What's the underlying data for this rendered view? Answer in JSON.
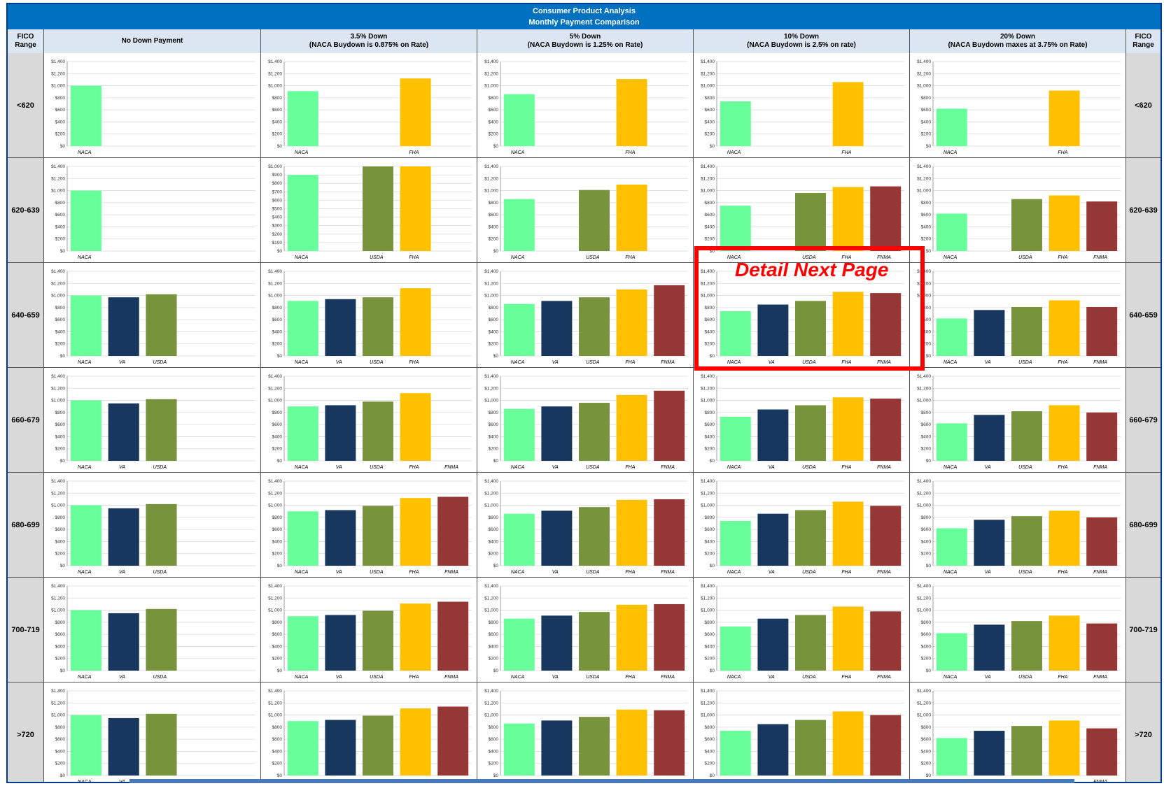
{
  "title": {
    "line1": "Consumer Product Analysis",
    "line2": "Monthly Payment Comparison"
  },
  "headers": {
    "fico_left": "FICO Range",
    "fico_right": "FICO Range",
    "columns": [
      {
        "line1": "No Down Payment",
        "line2": ""
      },
      {
        "line1": "3.5% Down",
        "line2": "(NACA Buydown is 0.875% on Rate)"
      },
      {
        "line1": "5% Down",
        "line2": "(NACA Buydown is 1.25% on Rate)"
      },
      {
        "line1": "10% Down",
        "line2": "(NACA Buydown is 2.5% on rate)"
      },
      {
        "line1": "20% Down",
        "line2": "(NACA Buydown maxes at 3.75% on Rate)"
      }
    ]
  },
  "fico_ranges": [
    "<620",
    "620-639",
    "640-659",
    "660-679",
    "680-699",
    "700-719",
    ">720"
  ],
  "annotation": {
    "text": "Detail Next Page"
  },
  "colors": {
    "NACA": "#66ff99",
    "VA": "#17375e",
    "USDA": "#77933c",
    "FHA": "#ffc000",
    "FNMA": "#953735",
    "title_bg": "#0070c0",
    "header_bg": "#dce6f2",
    "fico_bg": "#d9d9d9",
    "highlight": "#ff0000"
  },
  "chart_data": [
    {
      "type": "bar",
      "fico": "<620",
      "column": "No Down Payment",
      "ylim": [
        0,
        1400
      ],
      "yticks": [
        "$0",
        "$200",
        "$400",
        "$600",
        "$800",
        "$1,000",
        "$1,200",
        "$1,400"
      ],
      "categories": [
        "NACA",
        "",
        "",
        "",
        ""
      ],
      "values": [
        1000,
        null,
        null,
        null,
        null
      ]
    },
    {
      "type": "bar",
      "fico": "<620",
      "column": "3.5% Down",
      "ylim": [
        0,
        1400
      ],
      "yticks": [
        "$0",
        "$200",
        "$400",
        "$600",
        "$800",
        "$1,000",
        "$1,200",
        "$1,400"
      ],
      "categories": [
        "NACA",
        "",
        "",
        "FHA",
        ""
      ],
      "values": [
        910,
        null,
        null,
        1120,
        null
      ]
    },
    {
      "type": "bar",
      "fico": "<620",
      "column": "5% Down",
      "ylim": [
        0,
        1400
      ],
      "yticks": [
        "$0",
        "$200",
        "$400",
        "$600",
        "$800",
        "$1,000",
        "$1,200",
        "$1,400"
      ],
      "categories": [
        "NACA",
        "",
        "",
        "FHA",
        ""
      ],
      "values": [
        860,
        null,
        null,
        1110,
        null
      ]
    },
    {
      "type": "bar",
      "fico": "<620",
      "column": "10% Down",
      "ylim": [
        0,
        1400
      ],
      "yticks": [
        "$0",
        "$200",
        "$400",
        "$600",
        "$800",
        "$1,000",
        "$1,200",
        "$1,400"
      ],
      "categories": [
        "NACA",
        "",
        "",
        "FHA",
        ""
      ],
      "values": [
        740,
        null,
        null,
        1060,
        null
      ]
    },
    {
      "type": "bar",
      "fico": "<620",
      "column": "20% Down",
      "ylim": [
        0,
        1400
      ],
      "yticks": [
        "$0",
        "$200",
        "$400",
        "$600",
        "$800",
        "$1,000",
        "$1,200",
        "$1,400"
      ],
      "categories": [
        "NACA",
        "",
        "",
        "FHA",
        ""
      ],
      "values": [
        620,
        null,
        null,
        920,
        null
      ]
    },
    {
      "type": "bar",
      "fico": "620-639",
      "column": "No Down Payment",
      "ylim": [
        0,
        1400
      ],
      "yticks": [
        "$0",
        "$200",
        "$400",
        "$600",
        "$800",
        "$1,000",
        "$1,200",
        "$1,400"
      ],
      "categories": [
        "NACA",
        "",
        "",
        "",
        ""
      ],
      "values": [
        1000,
        null,
        null,
        null,
        null
      ]
    },
    {
      "type": "bar",
      "fico": "620-639",
      "column": "3.5% Down",
      "ylim": [
        0,
        1000
      ],
      "yticks": [
        "$0",
        "$100",
        "$200",
        "$300",
        "$400",
        "$500",
        "$600",
        "$700",
        "$800",
        "$900",
        "$1,000"
      ],
      "categories": [
        "NACA",
        "",
        "USDA",
        "FHA",
        ""
      ],
      "values": [
        900,
        null,
        1000,
        1000,
        null
      ]
    },
    {
      "type": "bar",
      "fico": "620-639",
      "column": "5% Down",
      "ylim": [
        0,
        1400
      ],
      "yticks": [
        "$0",
        "$200",
        "$400",
        "$600",
        "$800",
        "$1,000",
        "$1,200",
        "$1,400"
      ],
      "categories": [
        "NACA",
        "",
        "USDA",
        "FHA",
        ""
      ],
      "values": [
        860,
        null,
        1010,
        1100,
        null
      ]
    },
    {
      "type": "bar",
      "fico": "620-639",
      "column": "10% Down",
      "ylim": [
        0,
        1400
      ],
      "yticks": [
        "$0",
        "$200",
        "$400",
        "$600",
        "$800",
        "$1,000",
        "$1,200",
        "$1,400"
      ],
      "categories": [
        "NACA",
        "",
        "USDA",
        "FHA",
        "FNMA"
      ],
      "values": [
        750,
        null,
        960,
        1060,
        1070
      ]
    },
    {
      "type": "bar",
      "fico": "620-639",
      "column": "20% Down",
      "ylim": [
        0,
        1400
      ],
      "yticks": [
        "$0",
        "$200",
        "$400",
        "$600",
        "$800",
        "$1,000",
        "$1,200",
        "$1,400"
      ],
      "categories": [
        "NACA",
        "",
        "USDA",
        "FHA",
        "FNMA"
      ],
      "values": [
        620,
        null,
        860,
        920,
        820
      ]
    },
    {
      "type": "bar",
      "fico": "640-659",
      "column": "No Down Payment",
      "ylim": [
        0,
        1400
      ],
      "yticks": [
        "$0",
        "$200",
        "$400",
        "$600",
        "$800",
        "$1,000",
        "$1,200",
        "$1,400"
      ],
      "categories": [
        "NACA",
        "VA",
        "USDA",
        "",
        ""
      ],
      "values": [
        1000,
        970,
        1020,
        null,
        null
      ]
    },
    {
      "type": "bar",
      "fico": "640-659",
      "column": "3.5% Down",
      "ylim": [
        0,
        1400
      ],
      "yticks": [
        "$0",
        "$200",
        "$400",
        "$600",
        "$800",
        "$1,000",
        "$1,200",
        "$1,400"
      ],
      "categories": [
        "NACA",
        "VA",
        "USDA",
        "FHA",
        ""
      ],
      "values": [
        910,
        940,
        970,
        1120,
        null
      ]
    },
    {
      "type": "bar",
      "fico": "640-659",
      "column": "5% Down",
      "ylim": [
        0,
        1400
      ],
      "yticks": [
        "$0",
        "$200",
        "$400",
        "$600",
        "$800",
        "$1,000",
        "$1,200",
        "$1,400"
      ],
      "categories": [
        "NACA",
        "VA",
        "USDA",
        "FHA",
        "FNMA"
      ],
      "values": [
        860,
        910,
        970,
        1100,
        1170
      ]
    },
    {
      "type": "bar",
      "fico": "640-659",
      "column": "10% Down",
      "ylim": [
        0,
        1400
      ],
      "yticks": [
        "$0",
        "$200",
        "$400",
        "$600",
        "$800",
        "$1,000",
        "$1,200",
        "$1,400"
      ],
      "categories": [
        "NACA",
        "VA",
        "USDA",
        "FHA",
        "FNMA"
      ],
      "values": [
        740,
        850,
        910,
        1060,
        1040
      ]
    },
    {
      "type": "bar",
      "fico": "640-659",
      "column": "20% Down",
      "ylim": [
        0,
        1400
      ],
      "yticks": [
        "$0",
        "$200",
        "$400",
        "$600",
        "$800",
        "$1,000",
        "$1,200",
        "$1,400"
      ],
      "categories": [
        "NACA",
        "VA",
        "USDA",
        "FHA",
        "FNMA"
      ],
      "values": [
        620,
        760,
        810,
        920,
        810
      ]
    },
    {
      "type": "bar",
      "fico": "660-679",
      "column": "No Down Payment",
      "ylim": [
        0,
        1400
      ],
      "yticks": [
        "$0",
        "$200",
        "$400",
        "$600",
        "$800",
        "$1,000",
        "$1,200",
        "$1,400"
      ],
      "categories": [
        "NACA",
        "VA",
        "USDA",
        "",
        ""
      ],
      "values": [
        1000,
        950,
        1020,
        null,
        null
      ]
    },
    {
      "type": "bar",
      "fico": "660-679",
      "column": "3.5% Down",
      "ylim": [
        0,
        1400
      ],
      "yticks": [
        "$0",
        "$200",
        "$400",
        "$600",
        "$800",
        "$1,000",
        "$1,200",
        "$1,400"
      ],
      "categories": [
        "NACA",
        "VA",
        "USDA",
        "FHA",
        "FNMA"
      ],
      "values": [
        900,
        920,
        980,
        1120,
        null
      ]
    },
    {
      "type": "bar",
      "fico": "660-679",
      "column": "5% Down",
      "ylim": [
        0,
        1400
      ],
      "yticks": [
        "$0",
        "$200",
        "$400",
        "$600",
        "$800",
        "$1,000",
        "$1,200",
        "$1,400"
      ],
      "categories": [
        "NACA",
        "VA",
        "USDA",
        "FHA",
        "FNMA"
      ],
      "values": [
        860,
        900,
        960,
        1090,
        1160
      ]
    },
    {
      "type": "bar",
      "fico": "660-679",
      "column": "10% Down",
      "ylim": [
        0,
        1400
      ],
      "yticks": [
        "$0",
        "$200",
        "$400",
        "$600",
        "$800",
        "$1,000",
        "$1,200",
        "$1,400"
      ],
      "categories": [
        "NACA",
        "VA",
        "USDA",
        "FHA",
        "FNMA"
      ],
      "values": [
        730,
        850,
        920,
        1050,
        1030
      ]
    },
    {
      "type": "bar",
      "fico": "660-679",
      "column": "20% Down",
      "ylim": [
        0,
        1400
      ],
      "yticks": [
        "$0",
        "$200",
        "$400",
        "$600",
        "$800",
        "$1,000",
        "$1,200",
        "$1,400"
      ],
      "categories": [
        "NACA",
        "VA",
        "USDA",
        "FHA",
        "FNMA"
      ],
      "values": [
        620,
        760,
        820,
        920,
        800
      ]
    },
    {
      "type": "bar",
      "fico": "680-699",
      "column": "No Down Payment",
      "ylim": [
        0,
        1400
      ],
      "yticks": [
        "$0",
        "$200",
        "$400",
        "$600",
        "$800",
        "$1,000",
        "$1,200",
        "$1,400"
      ],
      "categories": [
        "NACA",
        "VA",
        "USDA",
        "",
        ""
      ],
      "values": [
        1000,
        950,
        1020,
        null,
        null
      ]
    },
    {
      "type": "bar",
      "fico": "680-699",
      "column": "3.5% Down",
      "ylim": [
        0,
        1400
      ],
      "yticks": [
        "$0",
        "$200",
        "$400",
        "$600",
        "$800",
        "$1,000",
        "$1,200",
        "$1,400"
      ],
      "categories": [
        "NACA",
        "VA",
        "USDA",
        "FHA",
        "FNMA"
      ],
      "values": [
        900,
        920,
        990,
        1120,
        1140
      ]
    },
    {
      "type": "bar",
      "fico": "680-699",
      "column": "5% Down",
      "ylim": [
        0,
        1400
      ],
      "yticks": [
        "$0",
        "$200",
        "$400",
        "$600",
        "$800",
        "$1,000",
        "$1,200",
        "$1,400"
      ],
      "categories": [
        "NACA",
        "VA",
        "USDA",
        "FHA",
        "FNMA"
      ],
      "values": [
        860,
        910,
        970,
        1090,
        1100
      ]
    },
    {
      "type": "bar",
      "fico": "680-699",
      "column": "10% Down",
      "ylim": [
        0,
        1400
      ],
      "yticks": [
        "$0",
        "$200",
        "$400",
        "$600",
        "$800",
        "$1,000",
        "$1,200",
        "$1,400"
      ],
      "categories": [
        "NACA",
        "VA",
        "USDA",
        "FHA",
        "FNMA"
      ],
      "values": [
        740,
        860,
        920,
        1060,
        990
      ]
    },
    {
      "type": "bar",
      "fico": "680-699",
      "column": "20% Down",
      "ylim": [
        0,
        1400
      ],
      "yticks": [
        "$0",
        "$200",
        "$400",
        "$600",
        "$800",
        "$1,000",
        "$1,200",
        "$1,400"
      ],
      "categories": [
        "NACA",
        "VA",
        "USDA",
        "FHA",
        "FNMA"
      ],
      "values": [
        620,
        760,
        820,
        910,
        800
      ]
    },
    {
      "type": "bar",
      "fico": "700-719",
      "column": "No Down Payment",
      "ylim": [
        0,
        1400
      ],
      "yticks": [
        "$0",
        "$200",
        "$400",
        "$600",
        "$800",
        "$1,000",
        "$1,200",
        "$1,400"
      ],
      "categories": [
        "NACA",
        "VA",
        "USDA",
        "",
        ""
      ],
      "values": [
        1000,
        950,
        1020,
        null,
        null
      ]
    },
    {
      "type": "bar",
      "fico": "700-719",
      "column": "3.5% Down",
      "ylim": [
        0,
        1400
      ],
      "yticks": [
        "$0",
        "$200",
        "$400",
        "$600",
        "$800",
        "$1,000",
        "$1,200",
        "$1,400"
      ],
      "categories": [
        "NACA",
        "VA",
        "USDA",
        "FHA",
        "FNMA"
      ],
      "values": [
        900,
        920,
        990,
        1110,
        1140
      ]
    },
    {
      "type": "bar",
      "fico": "700-719",
      "column": "5% Down",
      "ylim": [
        0,
        1400
      ],
      "yticks": [
        "$0",
        "$200",
        "$400",
        "$600",
        "$800",
        "$1,000",
        "$1,200",
        "$1,400"
      ],
      "categories": [
        "NACA",
        "VA",
        "USDA",
        "FHA",
        "FNMA"
      ],
      "values": [
        860,
        910,
        970,
        1090,
        1100
      ]
    },
    {
      "type": "bar",
      "fico": "700-719",
      "column": "10% Down",
      "ylim": [
        0,
        1400
      ],
      "yticks": [
        "$0",
        "$200",
        "$400",
        "$600",
        "$800",
        "$1,000",
        "$1,200",
        "$1,400"
      ],
      "categories": [
        "NACA",
        "VA",
        "USDA",
        "FHA",
        "FNMA"
      ],
      "values": [
        730,
        860,
        920,
        1060,
        980
      ]
    },
    {
      "type": "bar",
      "fico": "700-719",
      "column": "20% Down",
      "ylim": [
        0,
        1400
      ],
      "yticks": [
        "$0",
        "$200",
        "$400",
        "$600",
        "$800",
        "$1,000",
        "$1,200",
        "$1,400"
      ],
      "categories": [
        "NACA",
        "VA",
        "USDA",
        "FHA",
        "FNMA"
      ],
      "values": [
        620,
        760,
        820,
        910,
        780
      ]
    },
    {
      "type": "bar",
      "fico": ">720",
      "column": "No Down Payment",
      "ylim": [
        0,
        1400
      ],
      "yticks": [
        "$0",
        "$200",
        "$400",
        "$600",
        "$800",
        "$1,000",
        "$1,200",
        "$1,400"
      ],
      "categories": [
        "NACA",
        "VA",
        "USDA",
        "",
        ""
      ],
      "values": [
        1000,
        950,
        1020,
        null,
        null
      ]
    },
    {
      "type": "bar",
      "fico": ">720",
      "column": "3.5% Down",
      "ylim": [
        0,
        1400
      ],
      "yticks": [
        "$0",
        "$200",
        "$400",
        "$600",
        "$800",
        "$1,000",
        "$1,200",
        "$1,400"
      ],
      "categories": [
        "NACA",
        "VA",
        "USDA",
        "FHA",
        "FNMA"
      ],
      "values": [
        900,
        920,
        990,
        1110,
        1140
      ]
    },
    {
      "type": "bar",
      "fico": ">720",
      "column": "5% Down",
      "ylim": [
        0,
        1400
      ],
      "yticks": [
        "$0",
        "$200",
        "$400",
        "$600",
        "$800",
        "$1,000",
        "$1,200",
        "$1,400"
      ],
      "categories": [
        "NACA",
        "VA",
        "USDA",
        "FHA",
        "FNMA"
      ],
      "values": [
        860,
        910,
        970,
        1090,
        1080
      ]
    },
    {
      "type": "bar",
      "fico": ">720",
      "column": "10% Down",
      "ylim": [
        0,
        1400
      ],
      "yticks": [
        "$0",
        "$200",
        "$400",
        "$600",
        "$800",
        "$1,000",
        "$1,200",
        "$1,400"
      ],
      "categories": [
        "NACA",
        "VA",
        "USDA",
        "FHA",
        "FNMA"
      ],
      "values": [
        740,
        850,
        920,
        1060,
        1000
      ]
    },
    {
      "type": "bar",
      "fico": ">720",
      "column": "20% Down",
      "ylim": [
        0,
        1400
      ],
      "yticks": [
        "$0",
        "$200",
        "$400",
        "$600",
        "$800",
        "$1,000",
        "$1,200",
        "$1,400"
      ],
      "categories": [
        "NACA",
        "VA",
        "USDA",
        "FHA",
        "FNMA"
      ],
      "values": [
        620,
        740,
        820,
        910,
        780
      ]
    }
  ]
}
